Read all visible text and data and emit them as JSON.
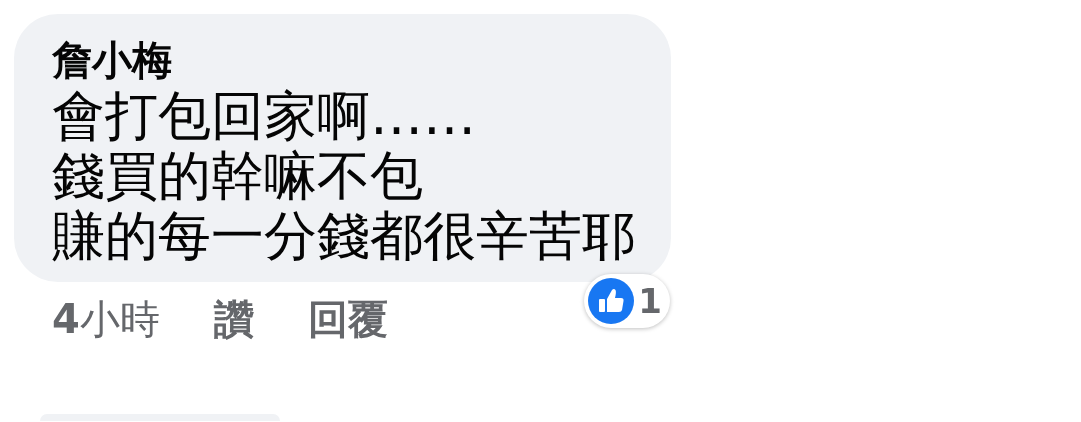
{
  "comment": {
    "author": "詹小梅",
    "lines": [
      "會打包回家啊……",
      "錢買的幹嘛不包",
      "賺的每一分錢都很辛苦耶"
    ],
    "time": "**4**小時",
    "actions": [
      "讚",
      "回覆"
    ],
    "reaction_count": "1"
  },
  "next_comment": {
    "visible": true
  }
}
